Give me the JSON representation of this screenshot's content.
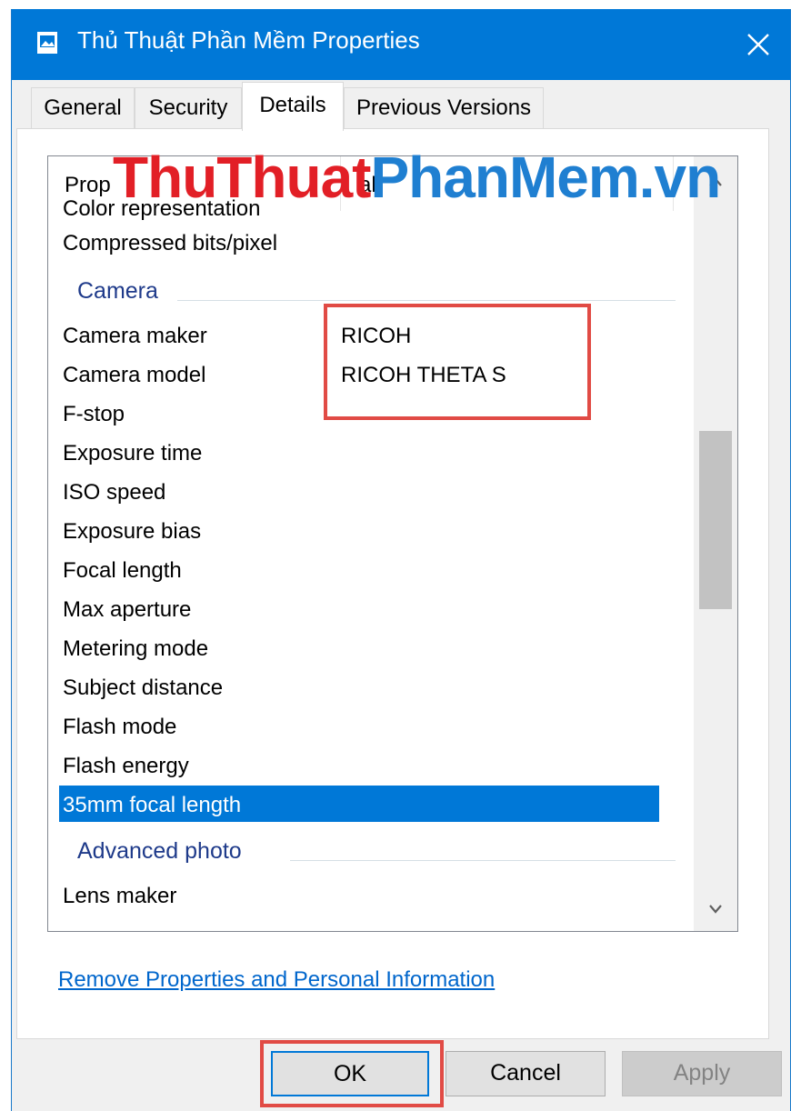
{
  "window": {
    "title": "Thủ Thuật Phần Mềm Properties",
    "accent_color": "#0078d7"
  },
  "tabs": [
    {
      "label": "General",
      "active": false
    },
    {
      "label": "Security",
      "active": false
    },
    {
      "label": "Details",
      "active": true
    },
    {
      "label": "Previous Versions",
      "active": false
    }
  ],
  "details": {
    "column_property": "Prop",
    "column_value": "al",
    "partial_top_row": "Color representation",
    "rows_top": [
      {
        "label": "Compressed bits/pixel"
      }
    ],
    "group_camera": "Camera",
    "camera_rows": [
      {
        "label": "Camera maker",
        "value": "RICOH"
      },
      {
        "label": "Camera model",
        "value": "RICOH THETA S"
      },
      {
        "label": "F-stop"
      },
      {
        "label": "Exposure time"
      },
      {
        "label": "ISO speed"
      },
      {
        "label": "Exposure bias"
      },
      {
        "label": "Focal length"
      },
      {
        "label": "Max aperture"
      },
      {
        "label": "Metering mode"
      },
      {
        "label": "Subject distance"
      },
      {
        "label": "Flash mode"
      },
      {
        "label": "Flash energy"
      },
      {
        "label": "35mm focal length",
        "selected": true
      }
    ],
    "group_advanced": "Advanced photo",
    "advanced_rows": [
      {
        "label": "Lens maker"
      }
    ]
  },
  "watermark": {
    "part1": "ThuThuat",
    "part2": "PhanMem.vn"
  },
  "link_text": "Remove Properties and Personal Information",
  "buttons": {
    "ok": "OK",
    "cancel": "Cancel",
    "apply": "Apply"
  },
  "scrollbar": {
    "position_fraction": 0.35
  }
}
